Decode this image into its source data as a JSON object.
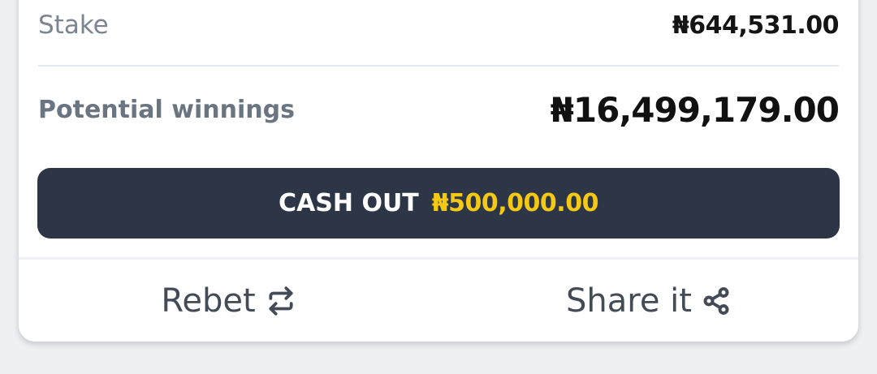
{
  "stake": {
    "label": "Stake",
    "value": "₦644,531.00"
  },
  "winnings": {
    "label": "Potential winnings",
    "value": "₦16,499,179.00"
  },
  "cashout": {
    "label": "CASH OUT",
    "amount": "₦500,000.00",
    "background_color": "#2d3646",
    "amount_color": "#f5c814"
  },
  "actions": {
    "rebet_label": "Rebet",
    "rebet_icon": "repeat-icon",
    "share_label": "Share it",
    "share_icon": "share-icon"
  }
}
